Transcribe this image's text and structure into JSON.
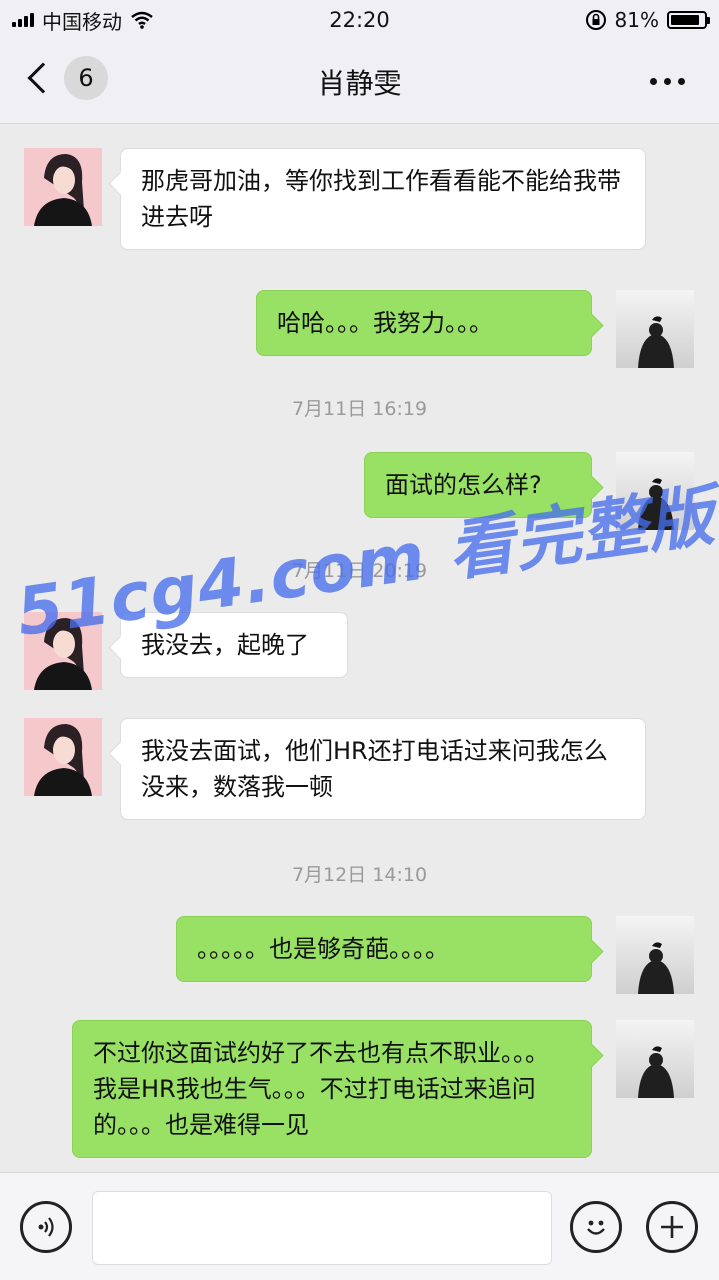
{
  "status_bar": {
    "carrier": "中国移动",
    "time": "22:20",
    "battery": "81%"
  },
  "header": {
    "unread_count": "6",
    "title": "肖静雯"
  },
  "messages": [
    {
      "text": "那虎哥加油，等你找到工作看看能不能给我带进去呀"
    },
    {
      "text": "哈哈。。。我努力。。。"
    },
    {
      "text": "面试的怎么样?"
    },
    {
      "text": "我没去，起晚了"
    },
    {
      "text": "我没去面试，他们HR还打电话过来问我怎么没来，数落我一顿"
    },
    {
      "text": "。。。。。也是够奇葩。。。。"
    },
    {
      "text": "不过你这面试约好了不去也有点不职业。。。我是HR我也生气。。。不过打电话过来追问的。。。也是难得一见"
    }
  ],
  "timestamps": [
    "7月11日 16:19",
    "7月11日 20:19",
    "7月12日 14:10"
  ],
  "watermark": "51cg4.com 看完整版",
  "icons": {
    "back": "chevron-left-icon",
    "more": "more-dots-icon",
    "voice": "voice-icon",
    "emoji": "emoji-icon",
    "add": "plus-icon"
  },
  "colors": {
    "outgoing_bubble": "#98e165",
    "incoming_bubble": "#ffffff",
    "chat_background": "#ebebeb",
    "watermark": "#466eeb"
  }
}
